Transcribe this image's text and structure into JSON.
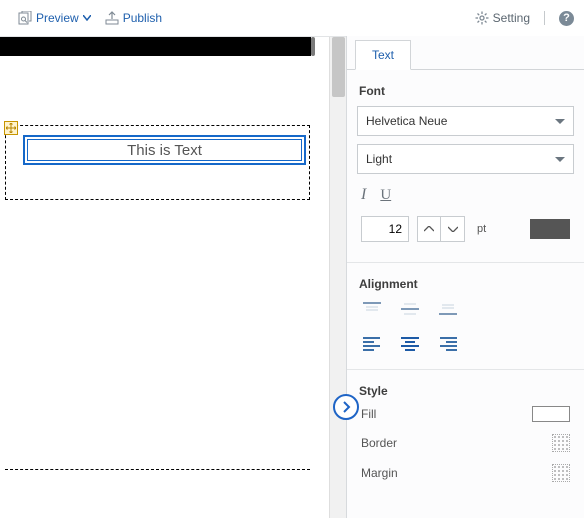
{
  "toolbar": {
    "preview": "Preview",
    "publish": "Publish",
    "setting": "Setting"
  },
  "canvas": {
    "text_content": "This is Text"
  },
  "panel": {
    "tab": "Text",
    "font_section": "Font",
    "font_family": "Helvetica Neue",
    "font_weight": "Light",
    "font_size": "12",
    "font_unit": "pt",
    "alignment_section": "Alignment",
    "style_section": "Style",
    "fill_label": "Fill",
    "border_label": "Border",
    "margin_label": "Margin"
  }
}
